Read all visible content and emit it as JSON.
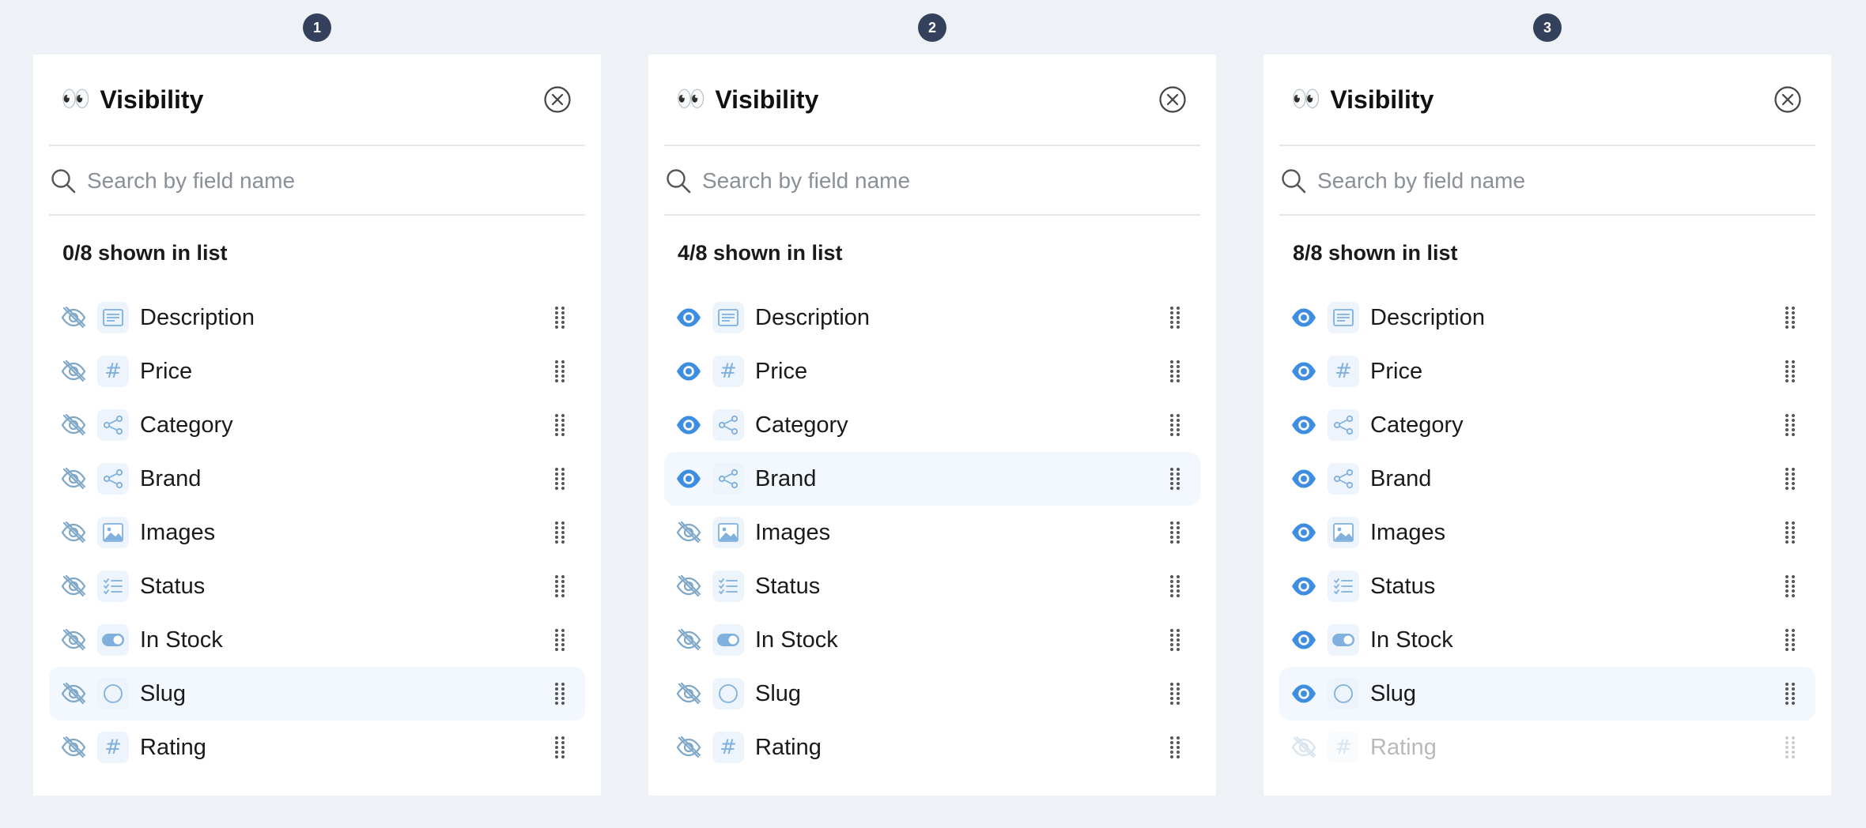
{
  "panels": [
    {
      "step": "1",
      "eyes": "👀",
      "title": "Visibility",
      "search_placeholder": "Search by field name",
      "count_text": "0/8 shown in list",
      "fields": [
        {
          "label": "Description",
          "icon": "text-icon",
          "visible": false,
          "highlighted": false,
          "muted": false
        },
        {
          "label": "Price",
          "icon": "hash-icon",
          "visible": false,
          "highlighted": false,
          "muted": false
        },
        {
          "label": "Category",
          "icon": "share-icon",
          "visible": false,
          "highlighted": false,
          "muted": false
        },
        {
          "label": "Brand",
          "icon": "share-icon",
          "visible": false,
          "highlighted": false,
          "muted": false
        },
        {
          "label": "Images",
          "icon": "image-icon",
          "visible": false,
          "highlighted": false,
          "muted": false
        },
        {
          "label": "Status",
          "icon": "checklist-icon",
          "visible": false,
          "highlighted": false,
          "muted": false
        },
        {
          "label": "In Stock",
          "icon": "toggle-icon",
          "visible": false,
          "highlighted": false,
          "muted": false
        },
        {
          "label": "Slug",
          "icon": "circle-icon",
          "visible": false,
          "highlighted": true,
          "muted": false
        },
        {
          "label": "Rating",
          "icon": "hash-icon",
          "visible": false,
          "highlighted": false,
          "muted": false
        }
      ]
    },
    {
      "step": "2",
      "eyes": "👀",
      "title": "Visibility",
      "search_placeholder": "Search by field name",
      "count_text": "4/8 shown in list",
      "fields": [
        {
          "label": "Description",
          "icon": "text-icon",
          "visible": true,
          "highlighted": false,
          "muted": false
        },
        {
          "label": "Price",
          "icon": "hash-icon",
          "visible": true,
          "highlighted": false,
          "muted": false
        },
        {
          "label": "Category",
          "icon": "share-icon",
          "visible": true,
          "highlighted": false,
          "muted": false
        },
        {
          "label": "Brand",
          "icon": "share-icon",
          "visible": true,
          "highlighted": true,
          "muted": false
        },
        {
          "label": "Images",
          "icon": "image-icon",
          "visible": false,
          "highlighted": false,
          "muted": false
        },
        {
          "label": "Status",
          "icon": "checklist-icon",
          "visible": false,
          "highlighted": false,
          "muted": false
        },
        {
          "label": "In Stock",
          "icon": "toggle-icon",
          "visible": false,
          "highlighted": false,
          "muted": false
        },
        {
          "label": "Slug",
          "icon": "circle-icon",
          "visible": false,
          "highlighted": false,
          "muted": false
        },
        {
          "label": "Rating",
          "icon": "hash-icon",
          "visible": false,
          "highlighted": false,
          "muted": false
        }
      ]
    },
    {
      "step": "3",
      "eyes": "👀",
      "title": "Visibility",
      "search_placeholder": "Search by field name",
      "count_text": "8/8 shown in list",
      "fields": [
        {
          "label": "Description",
          "icon": "text-icon",
          "visible": true,
          "highlighted": false,
          "muted": false
        },
        {
          "label": "Price",
          "icon": "hash-icon",
          "visible": true,
          "highlighted": false,
          "muted": false
        },
        {
          "label": "Category",
          "icon": "share-icon",
          "visible": true,
          "highlighted": false,
          "muted": false
        },
        {
          "label": "Brand",
          "icon": "share-icon",
          "visible": true,
          "highlighted": false,
          "muted": false
        },
        {
          "label": "Images",
          "icon": "image-icon",
          "visible": true,
          "highlighted": false,
          "muted": false
        },
        {
          "label": "Status",
          "icon": "checklist-icon",
          "visible": true,
          "highlighted": false,
          "muted": false
        },
        {
          "label": "In Stock",
          "icon": "toggle-icon",
          "visible": true,
          "highlighted": false,
          "muted": false
        },
        {
          "label": "Slug",
          "icon": "circle-icon",
          "visible": true,
          "highlighted": true,
          "muted": false
        },
        {
          "label": "Rating",
          "icon": "hash-icon",
          "visible": false,
          "highlighted": false,
          "muted": true
        }
      ]
    }
  ],
  "colors": {
    "accent": "#3d8ee0",
    "hidden_icon": "#7fa8c9",
    "icon_tint": "#7fb0de",
    "badge_bg": "#33415c",
    "highlight_row": "#f2f8fd",
    "page_bg": "#eef1f5"
  }
}
